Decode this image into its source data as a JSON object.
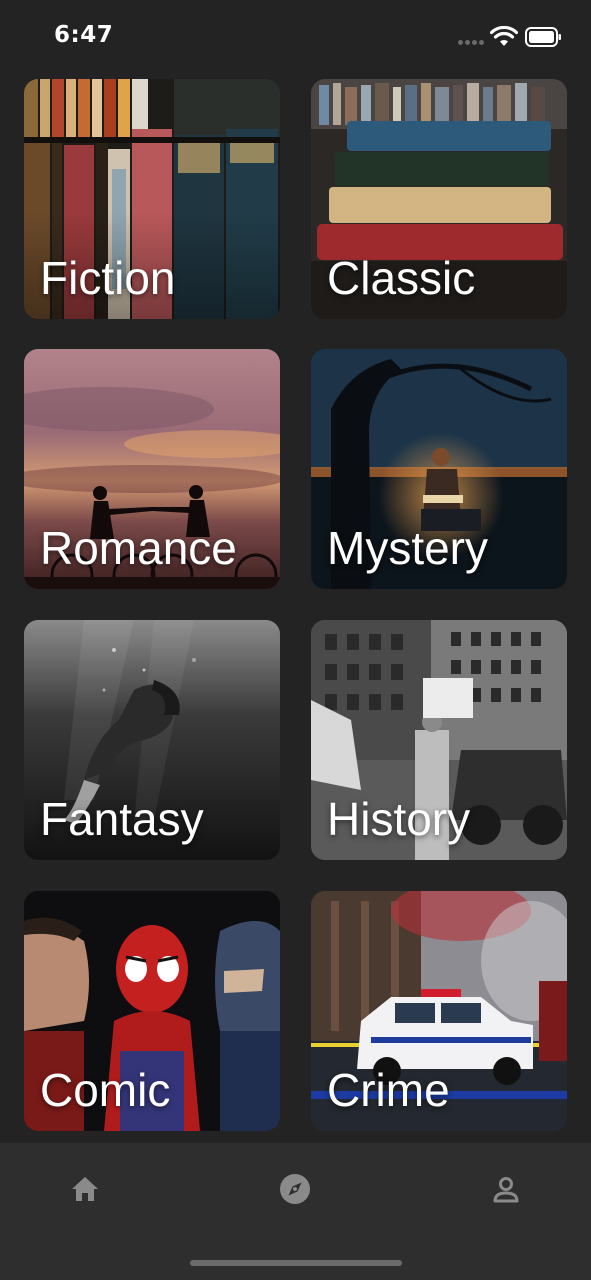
{
  "status_bar": {
    "time": "6:47",
    "icons": [
      "signal-dots-icon",
      "wifi-icon",
      "battery-icon"
    ]
  },
  "genres": [
    {
      "label": "Fiction",
      "image": "antique-books-shelf"
    },
    {
      "label": "Classic",
      "image": "stacked-vintage-books"
    },
    {
      "label": "Romance",
      "image": "couple-silhouette-sunset"
    },
    {
      "label": "Mystery",
      "image": "person-reading-lantern-night"
    },
    {
      "label": "Fantasy",
      "image": "woman-underwater-bw"
    },
    {
      "label": "History",
      "image": "vintage-city-street-bw"
    },
    {
      "label": "Comic",
      "image": "superhero-figurines"
    },
    {
      "label": "Crime",
      "image": "police-car-night"
    }
  ],
  "bottom_nav": {
    "items": [
      {
        "name": "home",
        "icon": "home-icon",
        "active": false
      },
      {
        "name": "explore",
        "icon": "compass-icon",
        "active": true
      },
      {
        "name": "profile",
        "icon": "person-icon",
        "active": false
      }
    ]
  },
  "colors": {
    "background": "#232323",
    "nav_background": "#2e2e2e",
    "icon_gray": "#8a8a8a",
    "text": "#ffffff"
  }
}
